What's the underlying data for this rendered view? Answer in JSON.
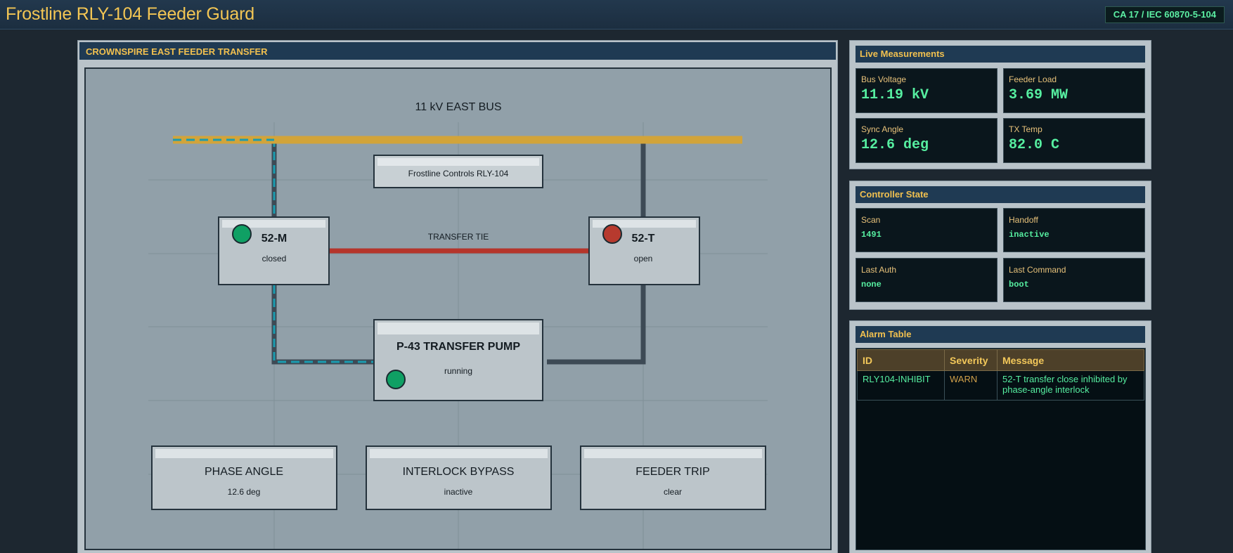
{
  "header": {
    "title": "Frostline RLY-104 Feeder Guard",
    "badge": "CA 17 / IEC 60870-5-104"
  },
  "diagram": {
    "panel_title": "CROWNSPIRE EAST FEEDER TRANSFER",
    "bus_label": "11 kV EAST BUS",
    "vendor_label": "Frostline Controls RLY-104",
    "tie_label": "TRANSFER TIE",
    "breakers": [
      {
        "name": "52-M",
        "state": "closed",
        "lamp_color": "#0fa064"
      },
      {
        "name": "52-T",
        "state": "open",
        "lamp_color": "#b73a2e"
      }
    ],
    "pump": {
      "name": "P-43 TRANSFER PUMP",
      "state": "running",
      "lamp_color": "#0fa064"
    },
    "status_boxes": [
      {
        "title": "PHASE ANGLE",
        "value": "12.6 deg"
      },
      {
        "title": "INTERLOCK BYPASS",
        "value": "inactive"
      },
      {
        "title": "FEEDER TRIP",
        "value": "clear"
      }
    ],
    "colors": {
      "bus": "#d2a43a",
      "energized_flow": "#1a9cb0",
      "tie": "#b5352b",
      "dead_line": "#3d4a55"
    }
  },
  "measurements": {
    "title": "Live Measurements",
    "items": [
      {
        "label": "Bus Voltage",
        "value": "11.19 kV"
      },
      {
        "label": "Feeder Load",
        "value": "3.69 MW"
      },
      {
        "label": "Sync Angle",
        "value": "12.6 deg"
      },
      {
        "label": "TX Temp",
        "value": "82.0 C"
      }
    ]
  },
  "controller": {
    "title": "Controller State",
    "items": [
      {
        "label": "Scan",
        "value": "1491"
      },
      {
        "label": "Handoff",
        "value": "inactive"
      },
      {
        "label": "Last Auth",
        "value": "none"
      },
      {
        "label": "Last Command",
        "value": "boot"
      }
    ]
  },
  "alarms": {
    "title": "Alarm Table",
    "columns": [
      "ID",
      "Severity",
      "Message"
    ],
    "rows": [
      {
        "id": "RLY104-INHIBIT",
        "severity": "WARN",
        "message": "52-T transfer close inhibited by phase-angle interlock"
      }
    ]
  }
}
